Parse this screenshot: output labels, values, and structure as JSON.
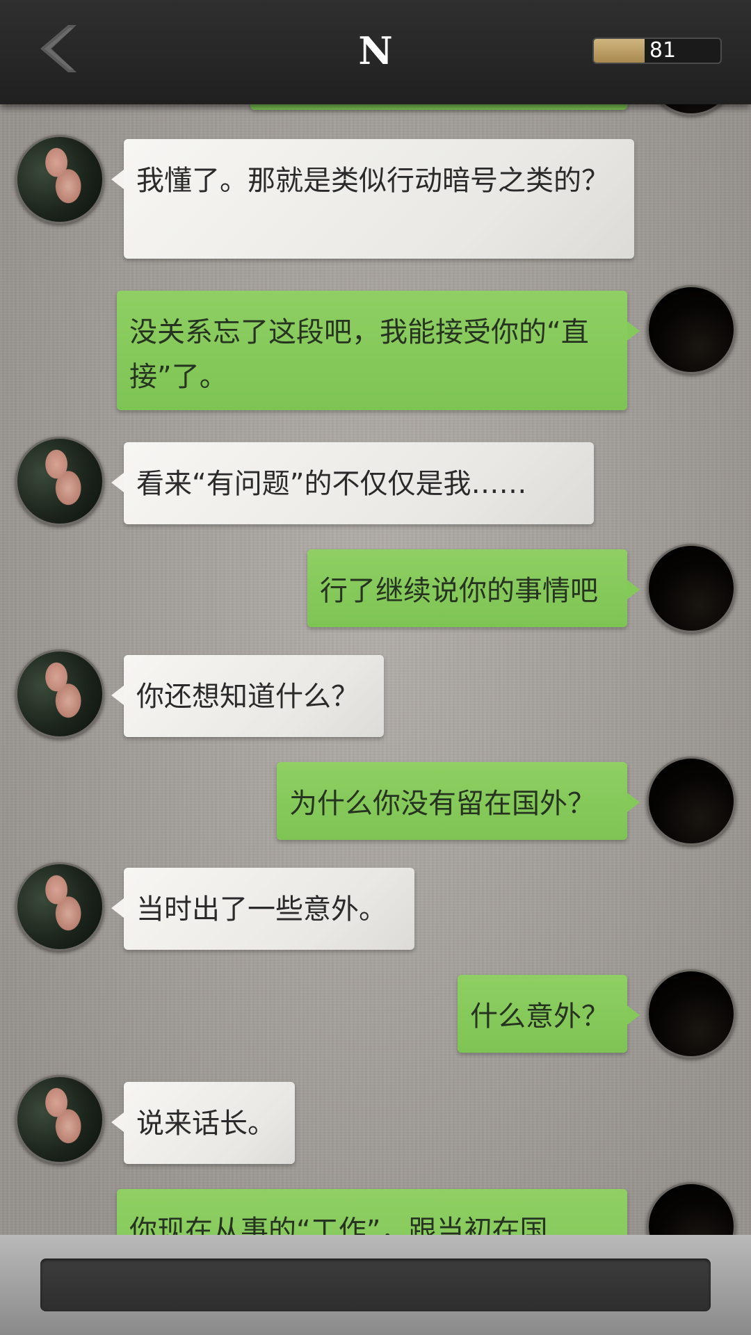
{
  "header": {
    "title": "N",
    "meter_value": "81",
    "meter_fill_fraction": 0.4
  },
  "messages": [
    {
      "from": "user",
      "text": ""
    },
    {
      "from": "contact",
      "text": "我懂了。那就是类似行动暗号之类的？"
    },
    {
      "from": "user",
      "text": "没关系忘了这段吧，我能接受你的“直接”了。"
    },
    {
      "from": "contact",
      "text": "看来“有问题”的不仅仅是我……"
    },
    {
      "from": "user",
      "text": "行了继续说你的事情吧"
    },
    {
      "from": "contact",
      "text": "你还想知道什么？"
    },
    {
      "from": "user",
      "text": "为什么你没有留在国外？"
    },
    {
      "from": "contact",
      "text": "当时出了一些意外。"
    },
    {
      "from": "user",
      "text": "什么意外？"
    },
    {
      "from": "contact",
      "text": "说来话长。"
    },
    {
      "from": "user",
      "text": "你现在从事的“工作”，跟当初在国"
    }
  ],
  "icons": {
    "back": "chevron-left-icon",
    "meter": "progress-meter",
    "avatar_contact": "contact-avatar",
    "avatar_user": "user-avatar"
  },
  "colors": {
    "header_bg": "#262626",
    "outgoing_bubble": "#84c95a",
    "incoming_bubble": "#efeeea",
    "background": "#a9a49f",
    "meter_fill": "#b99c62"
  }
}
